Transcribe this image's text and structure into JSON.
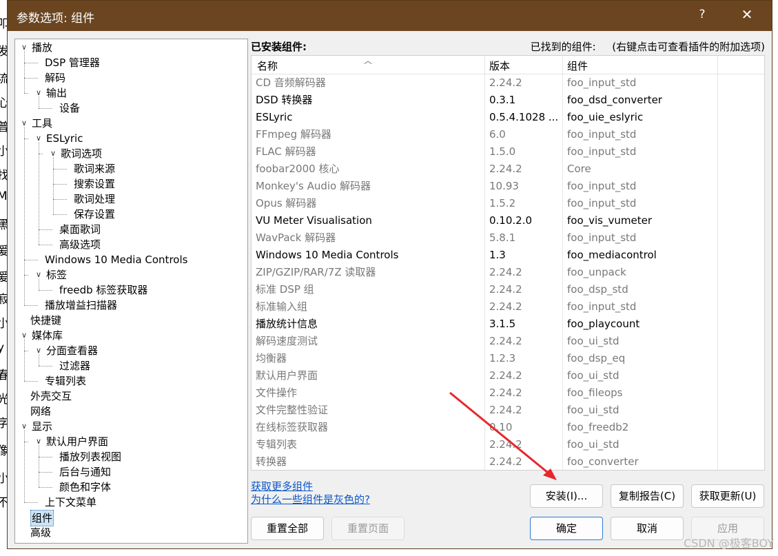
{
  "window": {
    "title": "参数选项: 组件",
    "help_glyph": "?",
    "close_glyph": "✕"
  },
  "tree": [
    {
      "label": "播放",
      "depth": 0,
      "expanded": true
    },
    {
      "label": "DSP 管理器",
      "depth": 1
    },
    {
      "label": "解码",
      "depth": 1
    },
    {
      "label": "输出",
      "depth": 1,
      "expanded": true
    },
    {
      "label": "设备",
      "depth": 2
    },
    {
      "label": "工具",
      "depth": 0,
      "expanded": true
    },
    {
      "label": "ESLyric",
      "depth": 1,
      "expanded": true
    },
    {
      "label": "歌词选项",
      "depth": 2,
      "expanded": true
    },
    {
      "label": "歌词来源",
      "depth": 3
    },
    {
      "label": "搜索设置",
      "depth": 3
    },
    {
      "label": "歌词处理",
      "depth": 3
    },
    {
      "label": "保存设置",
      "depth": 3
    },
    {
      "label": "桌面歌词",
      "depth": 2
    },
    {
      "label": "高级选项",
      "depth": 2
    },
    {
      "label": "Windows 10 Media Controls",
      "depth": 1
    },
    {
      "label": "标签",
      "depth": 1,
      "expanded": true
    },
    {
      "label": "freedb 标签获取器",
      "depth": 2
    },
    {
      "label": "播放增益扫描器",
      "depth": 1
    },
    {
      "label": "快捷键",
      "depth": 0
    },
    {
      "label": "媒体库",
      "depth": 0,
      "expanded": true
    },
    {
      "label": "分面查看器",
      "depth": 1,
      "expanded": true
    },
    {
      "label": "过滤器",
      "depth": 2
    },
    {
      "label": "专辑列表",
      "depth": 1
    },
    {
      "label": "外壳交互",
      "depth": 0
    },
    {
      "label": "网络",
      "depth": 0
    },
    {
      "label": "显示",
      "depth": 0,
      "expanded": true
    },
    {
      "label": "默认用户界面",
      "depth": 1,
      "expanded": true
    },
    {
      "label": "播放列表视图",
      "depth": 2
    },
    {
      "label": "后台与通知",
      "depth": 2
    },
    {
      "label": "颜色和字体",
      "depth": 2
    },
    {
      "label": "上下文菜单",
      "depth": 1
    },
    {
      "label": "组件",
      "depth": 0,
      "selected": true
    },
    {
      "label": "高级",
      "depth": 0
    }
  ],
  "panel": {
    "installed_label": "已安装组件:",
    "found_label": "已找到的组件:",
    "hint": "(右键点击可查看插件的附加选项)"
  },
  "columns": [
    "名称",
    "版本",
    "组件"
  ],
  "components": [
    {
      "name": "CD 音频解码器",
      "version": "2.24.2",
      "module": "foo_input_std",
      "gray": true
    },
    {
      "name": "DSD 转换器",
      "version": "0.3.1",
      "module": "foo_dsd_converter",
      "gray": false
    },
    {
      "name": "ESLyric",
      "version": "0.5.4.1028 ...",
      "module": "foo_uie_eslyric",
      "gray": false
    },
    {
      "name": "FFmpeg 解码器",
      "version": "6.0",
      "module": "foo_input_std",
      "gray": true
    },
    {
      "name": "FLAC 解码器",
      "version": "1.5.0",
      "module": "foo_input_std",
      "gray": true
    },
    {
      "name": "foobar2000 核心",
      "version": "2.24.2",
      "module": "Core",
      "gray": true
    },
    {
      "name": "Monkey's Audio 解码器",
      "version": "10.93",
      "module": "foo_input_std",
      "gray": true
    },
    {
      "name": "Opus 解码器",
      "version": "1.5.2",
      "module": "foo_input_std",
      "gray": true
    },
    {
      "name": "VU Meter Visualisation",
      "version": "0.10.2.0",
      "module": "foo_vis_vumeter",
      "gray": false
    },
    {
      "name": "WavPack 解码器",
      "version": "5.8.1",
      "module": "foo_input_std",
      "gray": true
    },
    {
      "name": "Windows 10 Media Controls",
      "version": "1.3",
      "module": "foo_mediacontrol",
      "gray": false
    },
    {
      "name": "ZIP/GZIP/RAR/7Z 读取器",
      "version": "2.24.2",
      "module": "foo_unpack",
      "gray": true
    },
    {
      "name": "标准 DSP 组",
      "version": "2.24.2",
      "module": "foo_dsp_std",
      "gray": true
    },
    {
      "name": "标准输入组",
      "version": "2.24.2",
      "module": "foo_input_std",
      "gray": true
    },
    {
      "name": "播放统计信息",
      "version": "3.1.5",
      "module": "foo_playcount",
      "gray": false
    },
    {
      "name": "解码速度测试",
      "version": "2.24.2",
      "module": "foo_ui_std",
      "gray": true
    },
    {
      "name": "均衡器",
      "version": "1.2.3",
      "module": "foo_dsp_eq",
      "gray": true
    },
    {
      "name": "默认用户界面",
      "version": "2.24.2",
      "module": "foo_ui_std",
      "gray": true
    },
    {
      "name": "文件操作",
      "version": "2.24.2",
      "module": "foo_fileops",
      "gray": true
    },
    {
      "name": "文件完整性验证",
      "version": "2.24.2",
      "module": "foo_ui_std",
      "gray": true
    },
    {
      "name": "在线标签获取器",
      "version": "0.10",
      "module": "foo_freedb2",
      "gray": true
    },
    {
      "name": "专辑列表",
      "version": "2.24.2",
      "module": "foo_ui_std",
      "gray": true
    },
    {
      "name": "转换器",
      "version": "2.24.2",
      "module": "foo_converter",
      "gray": true
    }
  ],
  "links": {
    "get_more": "获取更多组件",
    "why_gray": "为什么一些组件是灰色的?"
  },
  "buttons": {
    "install": "安装(I)...",
    "copy_report": "复制报告(C)",
    "get_updates": "获取更新(U)",
    "reset_all": "重置全部",
    "reset_page": "重置页面",
    "ok": "确定",
    "cancel": "取消",
    "apply": "应用"
  },
  "watermark": "CSDN @极客BOY",
  "background_chars": [
    "叩",
    "发",
    "流",
    "心",
    "普",
    "小",
    "找",
    "M",
    "黑",
    "爱",
    "爱",
    "寂",
    "小",
    "y",
    "春",
    "光",
    "字",
    "像",
    "小",
    "不"
  ],
  "colors": {
    "titlebar": "#6b4520",
    "annotation_arrow": "#e8262c",
    "selection": "#cce4f7"
  }
}
